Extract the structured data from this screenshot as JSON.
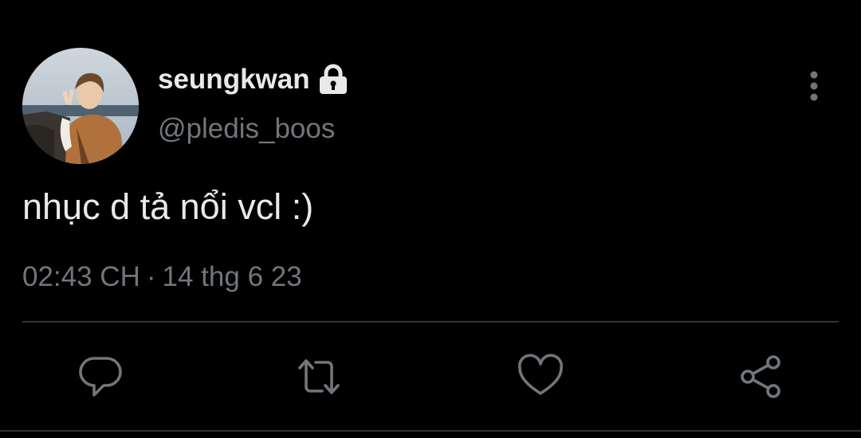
{
  "profile": {
    "display_name": "seungkwan",
    "handle": "@pledis_boos",
    "locked": true,
    "avatar_icon": "avatar"
  },
  "tweet": {
    "text": "nhục d tả nổi vcl :)",
    "time": "02:43 CH",
    "separator": "·",
    "date": "14 thg 6 23"
  },
  "actions": {
    "more_icon": "more-vertical-icon",
    "reply_icon": "reply-icon",
    "retweet_icon": "retweet-icon",
    "like_icon": "heart-icon",
    "share_icon": "share-icon"
  },
  "colors": {
    "background": "#000000",
    "primary_text": "#e7e9ea",
    "secondary_text": "#71767b",
    "divider": "#2f3336"
  }
}
